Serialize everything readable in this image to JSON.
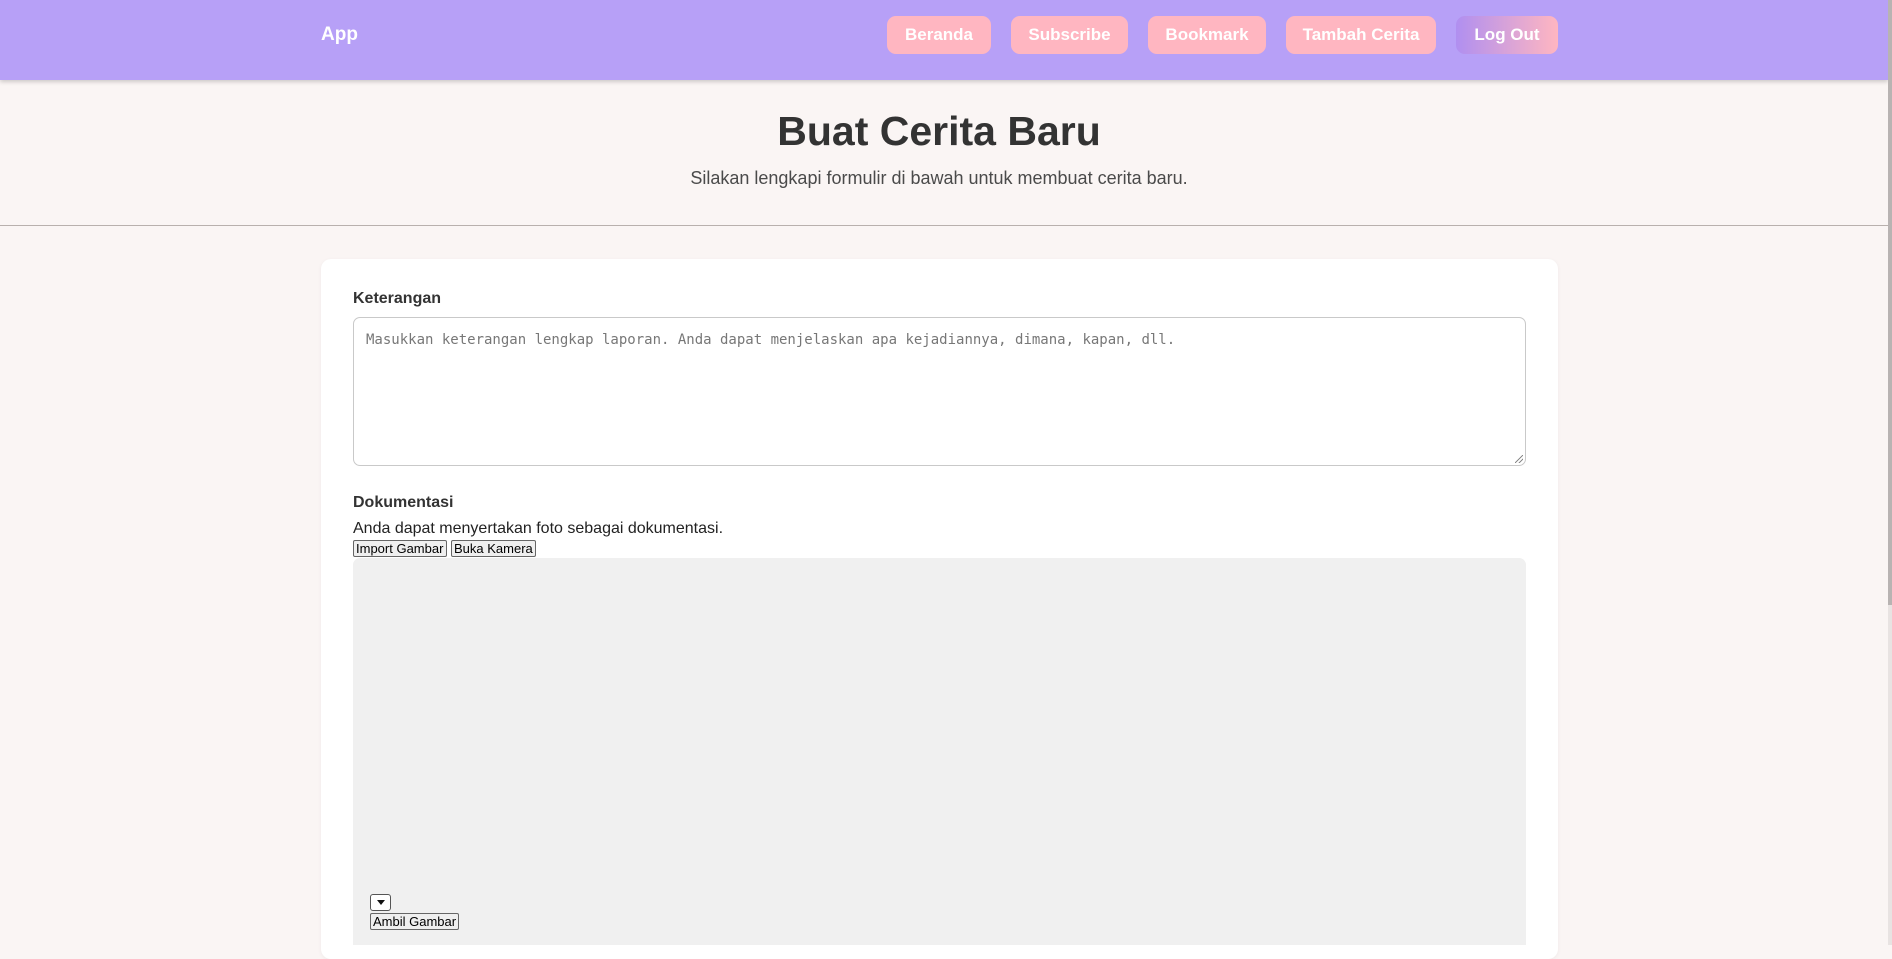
{
  "header": {
    "brand": "App",
    "nav": [
      {
        "label": "Beranda"
      },
      {
        "label": "Subscribe"
      },
      {
        "label": "Bookmark"
      },
      {
        "label": "Tambah Cerita"
      },
      {
        "label": "Log Out"
      }
    ]
  },
  "hero": {
    "title": "Buat Cerita Baru",
    "subtitle": "Silakan lengkapi formulir di bawah untuk membuat cerita baru."
  },
  "form": {
    "description_label": "Keterangan",
    "description_placeholder": "Masukkan keterangan lengkap laporan. Anda dapat menjelaskan apa kejadiannya, dimana, kapan, dll.",
    "documentation_label": "Dokumentasi",
    "documentation_hint": "Anda dapat menyertakan foto sebagai dokumentasi.",
    "import_button": "Import Gambar",
    "camera_button": "Buka Kamera",
    "capture_button": "Ambil Gambar"
  },
  "colors": {
    "header_bg": "#b7a0f7",
    "nav_button_bg": "#ffb6c1",
    "page_bg": "#faf5f4",
    "camera_area_bg": "#f0f0f0"
  }
}
